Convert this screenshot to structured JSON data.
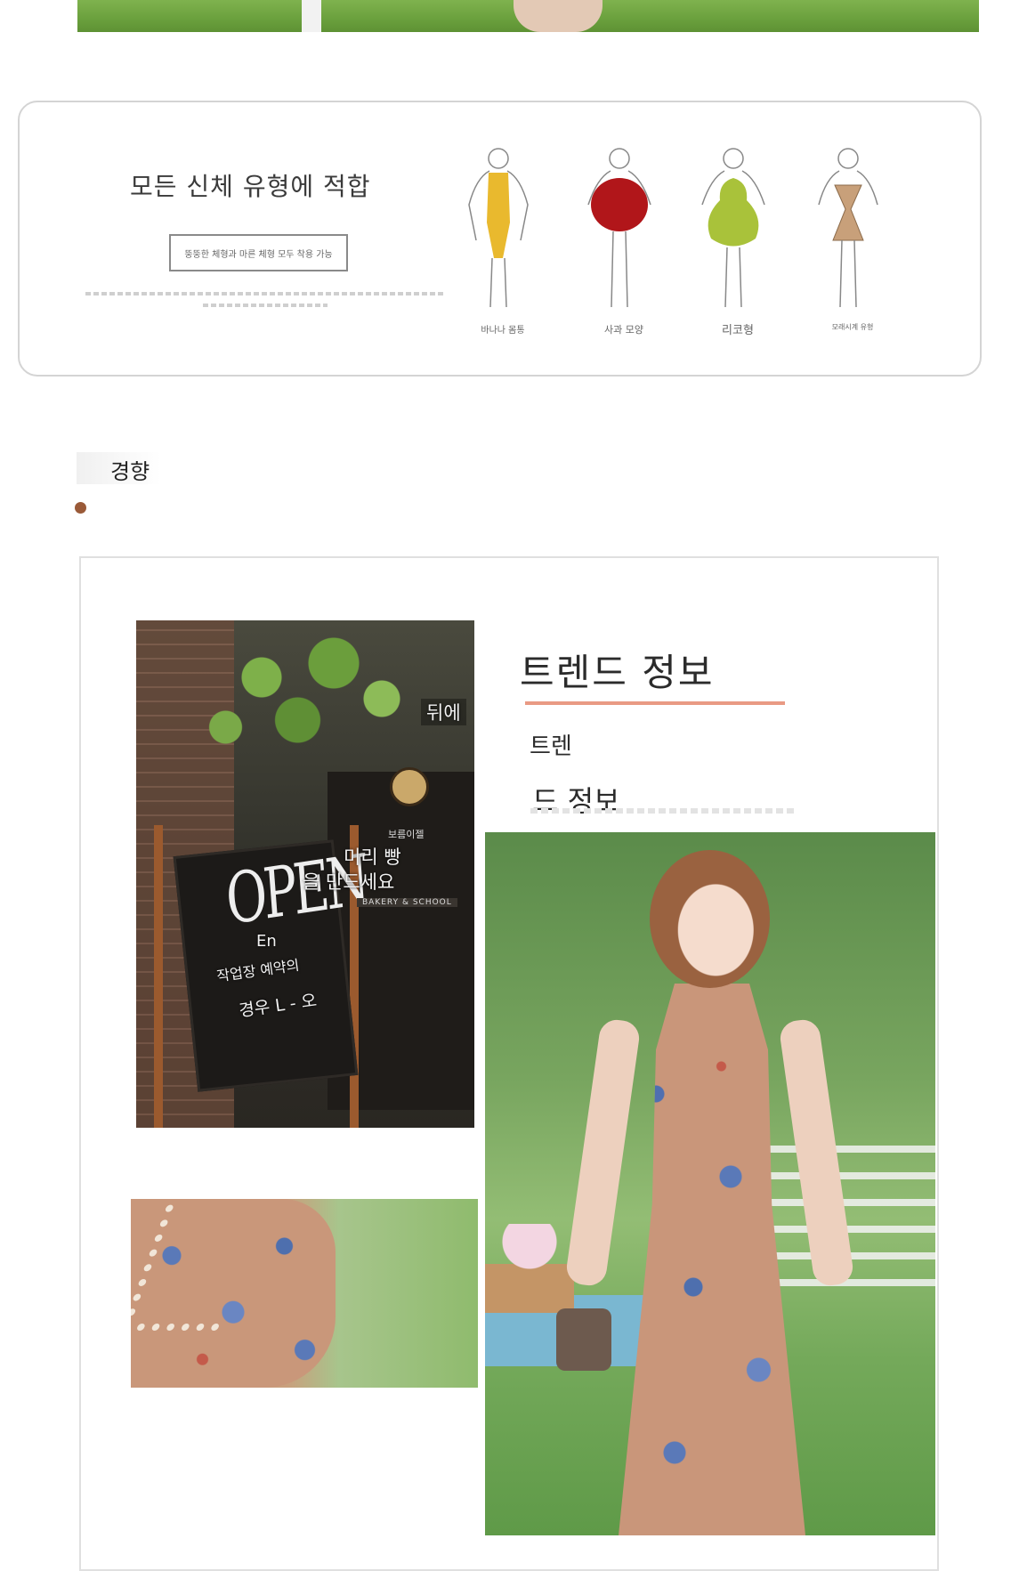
{
  "body_types": {
    "title": "모든 신체 유형에 적합",
    "subtitle": "뚱뚱한 체형과 마른 체형 모두 착용 가능",
    "types": [
      {
        "label": "바나나 몸통",
        "icon": "banana-body-icon",
        "color": "#e9b92e"
      },
      {
        "label": "사과 모양",
        "icon": "apple-body-icon",
        "color": "#b1161a"
      },
      {
        "label": "리코형",
        "icon": "pear-body-icon",
        "color": "#a9c23a"
      },
      {
        "label": "모래시계 유형",
        "icon": "hourglass-body-icon",
        "color": "#c8a07a"
      }
    ]
  },
  "trend_section": {
    "tab_label": "경향",
    "accent_color": "#9a5a38"
  },
  "trend_card": {
    "title": "트렌드 정보",
    "underline_color": "#e99a84",
    "sub_line_1": "트렌",
    "sub_line_2": "드 정보"
  },
  "bakery_photo": {
    "sign_back": "뒤에",
    "caption_small": "보름이젤",
    "line_1": "미리 빵",
    "line_2": "을 만드세요",
    "line_3": "작업장 예약의",
    "line_4": "경우 L - 오",
    "sign_word": "OPEN",
    "sign_small": "En",
    "shop_name": "BAKERY & SCHOOL"
  }
}
